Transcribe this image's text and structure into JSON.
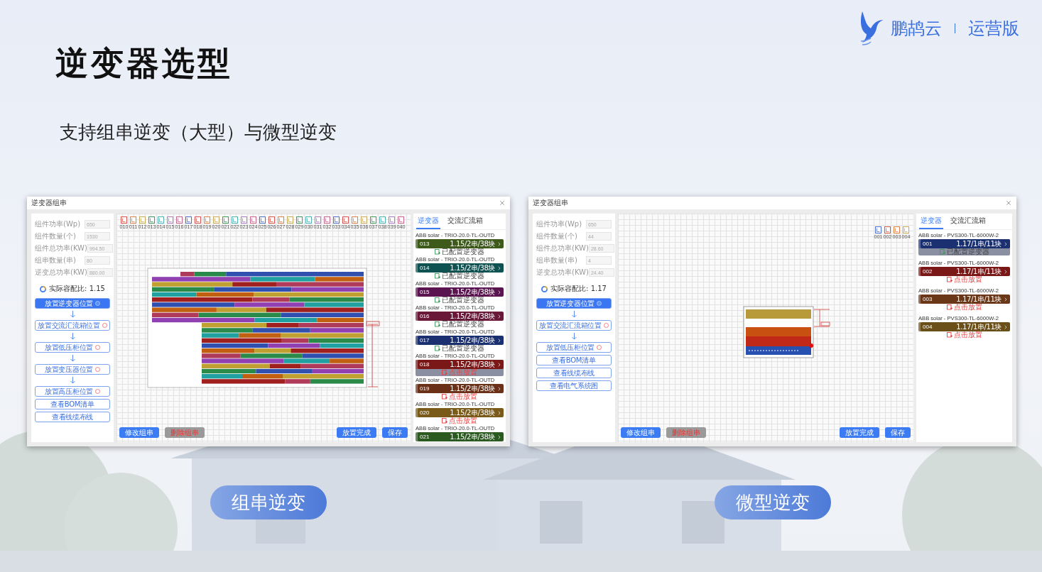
{
  "logo": {
    "brand": "鹏鸪云",
    "edition": "运营版"
  },
  "title": "逆变器选型",
  "subtitle": "支持组串逆变（大型）与微型逆变",
  "windows": [
    {
      "title": "逆变器组串",
      "kind": "string",
      "caption": "组串逆变",
      "fields": [
        {
          "label": "组件功率(Wp)",
          "value": "650"
        },
        {
          "label": "组件数量(个)",
          "value": "1530"
        },
        {
          "label": "组件总功率(KW)",
          "value": "994.50"
        },
        {
          "label": "组串数量(串)",
          "value": "80"
        },
        {
          "label": "逆变总功率(KW)",
          "value": "880.00"
        }
      ],
      "ratio": "实际容配比: 1.15",
      "steps": [
        {
          "label": "放置逆变器位置",
          "kind": "step",
          "active": true
        },
        {
          "label": "放置交流汇流箱位置",
          "kind": "step",
          "active": false
        },
        {
          "label": "放置低压柜位置",
          "kind": "step",
          "active": false
        },
        {
          "label": "放置变压器位置",
          "kind": "step",
          "active": false
        },
        {
          "label": "放置高压柜位置",
          "kind": "step",
          "active": false
        },
        {
          "label": "查看BOM清单",
          "kind": "link"
        },
        {
          "label": "查看线缆布线",
          "kind": "link"
        }
      ],
      "left_buttons": [
        {
          "label": "修改组串",
          "kind": "primary"
        },
        {
          "label": "删除组串",
          "kind": "danger"
        }
      ],
      "right_buttons": [
        {
          "label": "放置完成",
          "kind": "primary"
        },
        {
          "label": "保存",
          "kind": "primary"
        }
      ],
      "chips": [
        {
          "label": "010",
          "color": "#d9534f"
        },
        {
          "label": "011",
          "color": "#e08040"
        },
        {
          "label": "012",
          "color": "#c9a85a"
        },
        {
          "label": "013",
          "color": "#3f9a5c"
        },
        {
          "label": "014",
          "color": "#4fb3b3"
        },
        {
          "label": "015",
          "color": "#b377cc"
        },
        {
          "label": "016",
          "color": "#c9658a"
        },
        {
          "label": "017",
          "color": "#5070d0"
        },
        {
          "label": "018",
          "color": "#d9534f"
        },
        {
          "label": "019",
          "color": "#e08040"
        },
        {
          "label": "020",
          "color": "#c9a85a"
        },
        {
          "label": "021",
          "color": "#3f9a5c"
        },
        {
          "label": "022",
          "color": "#4fb3b3"
        },
        {
          "label": "023",
          "color": "#b377cc"
        },
        {
          "label": "024",
          "color": "#c9658a"
        },
        {
          "label": "025",
          "color": "#5070d0"
        },
        {
          "label": "026",
          "color": "#d9534f"
        },
        {
          "label": "027",
          "color": "#e08040"
        },
        {
          "label": "028",
          "color": "#c9a85a"
        },
        {
          "label": "029",
          "color": "#3f9a5c"
        },
        {
          "label": "030",
          "color": "#4fb3b3"
        },
        {
          "label": "031",
          "color": "#b377cc"
        },
        {
          "label": "032",
          "color": "#c9658a"
        },
        {
          "label": "033",
          "color": "#5070d0"
        },
        {
          "label": "034",
          "color": "#d9534f"
        },
        {
          "label": "035",
          "color": "#e08040"
        },
        {
          "label": "036",
          "color": "#c9a85a"
        },
        {
          "label": "037",
          "color": "#3f9a5c"
        },
        {
          "label": "038",
          "color": "#4fb3b3"
        },
        {
          "label": "039",
          "color": "#b377cc"
        },
        {
          "label": "040",
          "color": "#c9658a"
        }
      ],
      "tabs": [
        {
          "label": "逆变器",
          "selected": true
        },
        {
          "label": "交流汇流箱",
          "selected": false
        }
      ],
      "inverters": [
        {
          "model": "ABB solar - TRIO-20.0-TL-OUTD",
          "id": "013",
          "spec": "1.15/2串/38块",
          "color": "#3d5a1a",
          "status": "已配置逆变器",
          "configured": true,
          "selected": false
        },
        {
          "model": "ABB solar - TRIO-20.0-TL-OUTD",
          "id": "014",
          "spec": "1.15/2串/38块",
          "color": "#0f5252",
          "status": "已配置逆变器",
          "configured": true,
          "selected": false
        },
        {
          "model": "ABB solar - TRIO-20.0-TL-OUTD",
          "id": "015",
          "spec": "1.15/2串/38块",
          "color": "#5a1450",
          "status": "已配置逆变器",
          "configured": true,
          "selected": false
        },
        {
          "model": "ABB solar - TRIO-20.0-TL-OUTD",
          "id": "016",
          "spec": "1.15/2串/38块",
          "color": "#6a1838",
          "status": "已配置逆变器",
          "configured": true,
          "selected": false
        },
        {
          "model": "ABB solar - TRIO-20.0-TL-OUTD",
          "id": "017",
          "spec": "1.15/2串/38块",
          "color": "#1a3070",
          "status": "已配置逆变器",
          "configured": true,
          "selected": false
        },
        {
          "model": "ABB solar - TRIO-20.0-TL-OUTD",
          "id": "018",
          "spec": "1.15/2串/38块",
          "color": "#7a1818",
          "status": "点击放置",
          "configured": false,
          "selected": true
        },
        {
          "model": "ABB solar - TRIO-20.0-TL-OUTD",
          "id": "019",
          "spec": "1.15/2串/38块",
          "color": "#6a3018",
          "status": "点击放置",
          "configured": false,
          "selected": false
        },
        {
          "model": "ABB solar - TRIO-20.0-TL-OUTD",
          "id": "020",
          "spec": "1.15/2串/38块",
          "color": "#7a5a18",
          "status": "点击放置",
          "configured": false,
          "selected": false
        },
        {
          "model": "ABB solar - TRIO-20.0-TL-OUTD",
          "id": "021",
          "spec": "1.15/2串/38块",
          "color": "#2a5a20",
          "selected": false
        }
      ]
    },
    {
      "title": "逆变器组串",
      "kind": "micro",
      "caption": "微型逆变",
      "fields": [
        {
          "label": "组件功率(Wp)",
          "value": "650"
        },
        {
          "label": "组件数量(个)",
          "value": "44"
        },
        {
          "label": "组件总功率(KW)",
          "value": "28.60"
        },
        {
          "label": "组串数量(串)",
          "value": "4"
        },
        {
          "label": "逆变总功率(KW)",
          "value": "24.40"
        }
      ],
      "ratio": "实际容配比: 1.17",
      "steps": [
        {
          "label": "放置逆变器位置",
          "kind": "step",
          "active": true
        },
        {
          "label": "放置交流汇流箱位置",
          "kind": "step",
          "active": false
        },
        {
          "label": "放置低压柜位置",
          "kind": "step",
          "active": false
        },
        {
          "label": "查看BOM清单",
          "kind": "link"
        },
        {
          "label": "查看线缆布线",
          "kind": "link"
        },
        {
          "label": "查看电气系统图",
          "kind": "link"
        }
      ],
      "chips": [
        {
          "label": "001",
          "color": "#5070d0"
        },
        {
          "label": "002",
          "color": "#d9534f"
        },
        {
          "label": "003",
          "color": "#e08040"
        },
        {
          "label": "004",
          "color": "#c9a85a"
        }
      ],
      "left_buttons": [
        {
          "label": "修改组串",
          "kind": "primary"
        },
        {
          "label": "删除组串",
          "kind": "danger"
        }
      ],
      "right_buttons": [
        {
          "label": "放置完成",
          "kind": "primary"
        },
        {
          "label": "保存",
          "kind": "primary"
        }
      ],
      "tabs": [
        {
          "label": "逆变器",
          "selected": true
        },
        {
          "label": "交流汇流箱",
          "selected": false
        }
      ],
      "inverters": [
        {
          "model": "ABB solar - PVS300-TL-6000W-2",
          "id": "001",
          "spec": "1.17/1串/11块",
          "color": "#1a3070",
          "status": "已配置逆变器",
          "configured": true,
          "selected": true
        },
        {
          "model": "ABB solar - PVS300-TL-6000W-2",
          "id": "002",
          "spec": "1.17/1串/11块",
          "color": "#7a1818",
          "status": "点击放置",
          "configured": false,
          "selected": false
        },
        {
          "model": "ABB solar - PVS300-TL-6000W-2",
          "id": "003",
          "spec": "1.17/1串/11块",
          "color": "#6a3818",
          "status": "点击放置",
          "configured": false,
          "selected": false
        },
        {
          "model": "ABB solar - PVS300-TL-6000W-2",
          "id": "004",
          "spec": "1.17/1串/11块",
          "color": "#6a5018",
          "status": "点击放置",
          "configured": false,
          "selected": false
        }
      ]
    }
  ]
}
